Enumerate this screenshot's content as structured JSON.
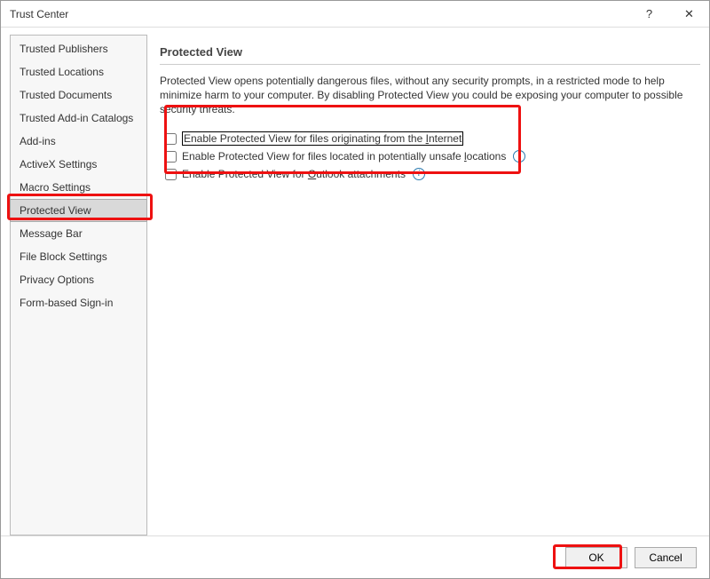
{
  "window": {
    "title": "Trust Center"
  },
  "sidebar": {
    "items": [
      {
        "label": "Trusted Publishers"
      },
      {
        "label": "Trusted Locations"
      },
      {
        "label": "Trusted Documents"
      },
      {
        "label": "Trusted Add-in Catalogs"
      },
      {
        "label": "Add-ins"
      },
      {
        "label": "ActiveX Settings"
      },
      {
        "label": "Macro Settings"
      },
      {
        "label": "Protected View",
        "selected": true
      },
      {
        "label": "Message Bar"
      },
      {
        "label": "File Block Settings"
      },
      {
        "label": "Privacy Options"
      },
      {
        "label": "Form-based Sign-in"
      }
    ]
  },
  "main": {
    "heading": "Protected View",
    "description": "Protected View opens potentially dangerous files, without any security prompts, in a restricted mode to help minimize harm to your computer. By disabling Protected View you could be exposing your computer to possible security threats.",
    "options": [
      {
        "pre": "Enable Protected View for files originating from the ",
        "u": "I",
        "post": "nternet",
        "checked": false,
        "focused": true,
        "info": false
      },
      {
        "pre": "Enable Protected View for files located in potentially unsafe ",
        "u": "l",
        "post": "ocations",
        "checked": false,
        "focused": false,
        "info": true
      },
      {
        "pre": "Enable Protected View for ",
        "u": "O",
        "post": "utlook attachments",
        "checked": false,
        "focused": false,
        "info": true
      }
    ]
  },
  "footer": {
    "ok": "OK",
    "cancel": "Cancel"
  },
  "icons": {
    "help": "?",
    "close": "✕",
    "info": "i"
  }
}
